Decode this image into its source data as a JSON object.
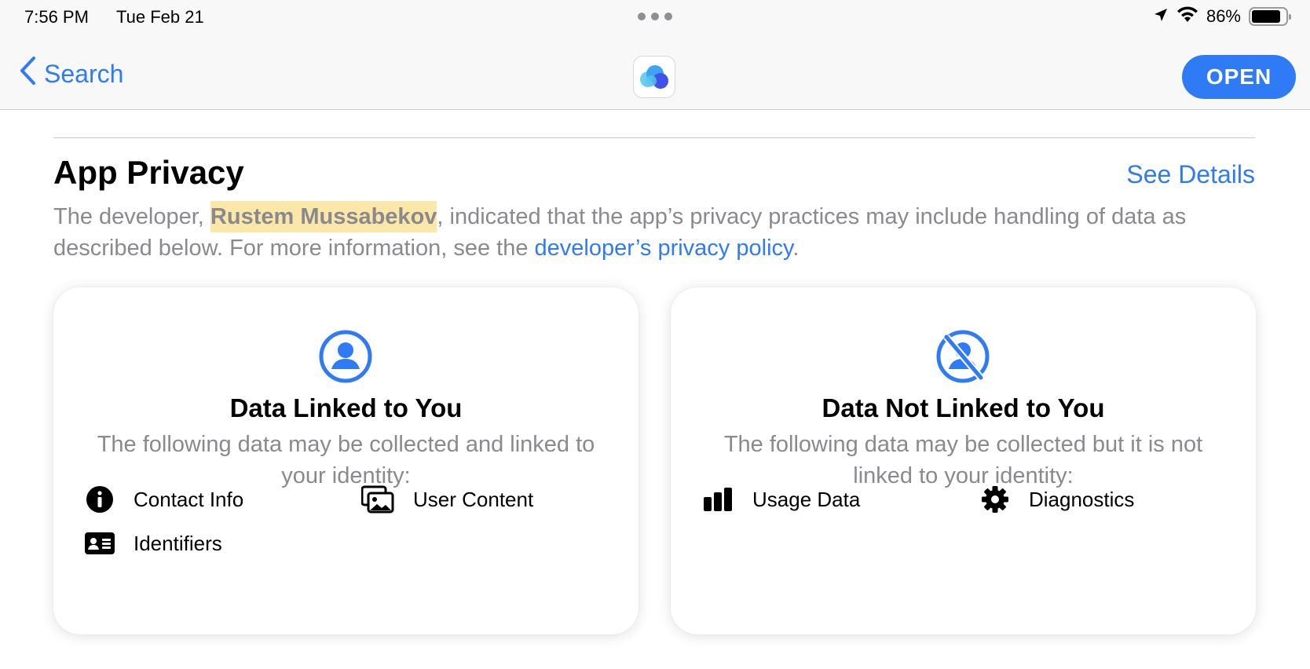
{
  "status_bar": {
    "time": "7:56 PM",
    "date": "Tue Feb 21",
    "battery": "86%",
    "battery_level": 0.86
  },
  "nav": {
    "back_label": "Search",
    "open_label": "OPEN"
  },
  "section": {
    "title": "App Privacy",
    "see_details": "See Details",
    "desc_prefix": "The developer, ",
    "developer_name": "Rustem Mussabekov",
    "desc_middle": ", indicated that the app’s privacy practices may include handling of data as described below. For more information, see the ",
    "policy_link": "developer’s privacy policy",
    "desc_suffix": "."
  },
  "cards": {
    "linked": {
      "title": "Data Linked to You",
      "subtitle": "The following data may be collected and linked to your identity:",
      "items": [
        "Contact Info",
        "User Content",
        "Identifiers"
      ]
    },
    "not_linked": {
      "title": "Data Not Linked to You",
      "subtitle": "The following data may be collected but it is not linked to your identity:",
      "items": [
        "Usage Data",
        "Diagnostics"
      ]
    }
  },
  "colors": {
    "accent": "#2f7bf5",
    "secondary_text": "#8a8a8e",
    "highlight": "#fbe7a8"
  }
}
